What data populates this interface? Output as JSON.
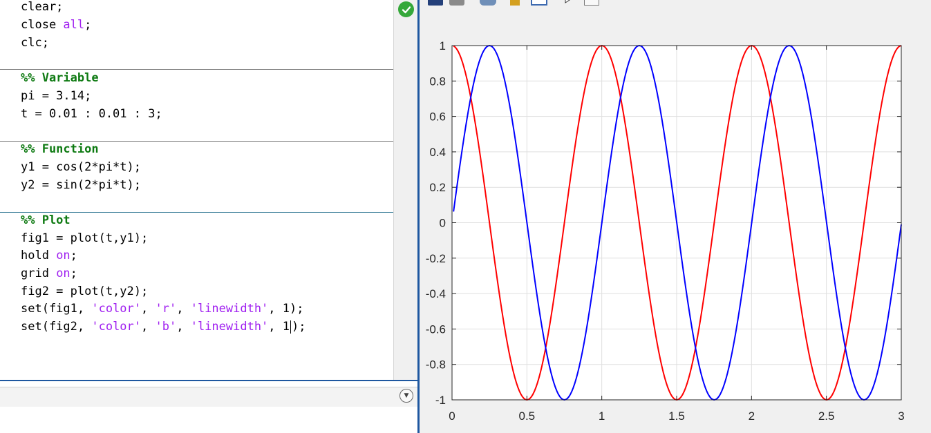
{
  "editor": {
    "lines": {
      "l1": "clear;",
      "l2a": "close ",
      "l2b": "all",
      "l2c": ";",
      "l3": "clc;",
      "c1": "%% Variable",
      "l4": "pi = 3.14;",
      "l5": "t = 0.01 : 0.01 : 3;",
      "c2": "%% Function",
      "l6": "y1 = cos(2*pi*t);",
      "l7": "y2 = sin(2*pi*t);",
      "c3": "%% Plot",
      "l8": "fig1 = plot(t,y1);",
      "l9a": "hold ",
      "l9b": "on",
      "l9c": ";",
      "l10a": "grid ",
      "l10b": "on",
      "l10c": ";",
      "l11": "fig2 = plot(t,y2);",
      "l12a": "set(fig1, ",
      "l12b": "'color'",
      "l12c": ", ",
      "l12d": "'r'",
      "l12e": ", ",
      "l12f": "'linewidth'",
      "l12g": ", 1);",
      "l13a": "set(fig2, ",
      "l13b": "'color'",
      "l13c": ", ",
      "l13d": "'b'",
      "l13e": ", ",
      "l13f": "'linewidth'",
      "l13g": ", 1",
      "l13h": ");"
    }
  },
  "status_icon": "checkmark-icon",
  "command_window": {
    "menu_icon": "chevron-down-icon"
  },
  "toolbar": {
    "icons": [
      "new-figure-icon",
      "print-icon",
      "link-icon",
      "insert-colorbar-icon",
      "insert-legend-icon",
      "pointer-icon",
      "property-editor-icon"
    ]
  },
  "chart_data": {
    "type": "line",
    "xlim": [
      0,
      3
    ],
    "ylim": [
      -1,
      1
    ],
    "x_ticks": [
      "0",
      "0.5",
      "1",
      "1.5",
      "2",
      "2.5",
      "3"
    ],
    "y_ticks": [
      "1",
      "0.8",
      "0.6",
      "0.4",
      "0.2",
      "0",
      "-0.2",
      "-0.4",
      "-0.6",
      "-0.8",
      "-1"
    ],
    "grid": true,
    "series": [
      {
        "expression": "cos(2*pi*t)",
        "color": "#ff0000",
        "t_start": 0.01,
        "t_end": 3,
        "t_step": 0.01
      },
      {
        "expression": "sin(2*pi*t)",
        "color": "#0000ff",
        "t_start": 0.01,
        "t_end": 3,
        "t_step": 0.01
      }
    ],
    "pi_value": 3.14
  }
}
